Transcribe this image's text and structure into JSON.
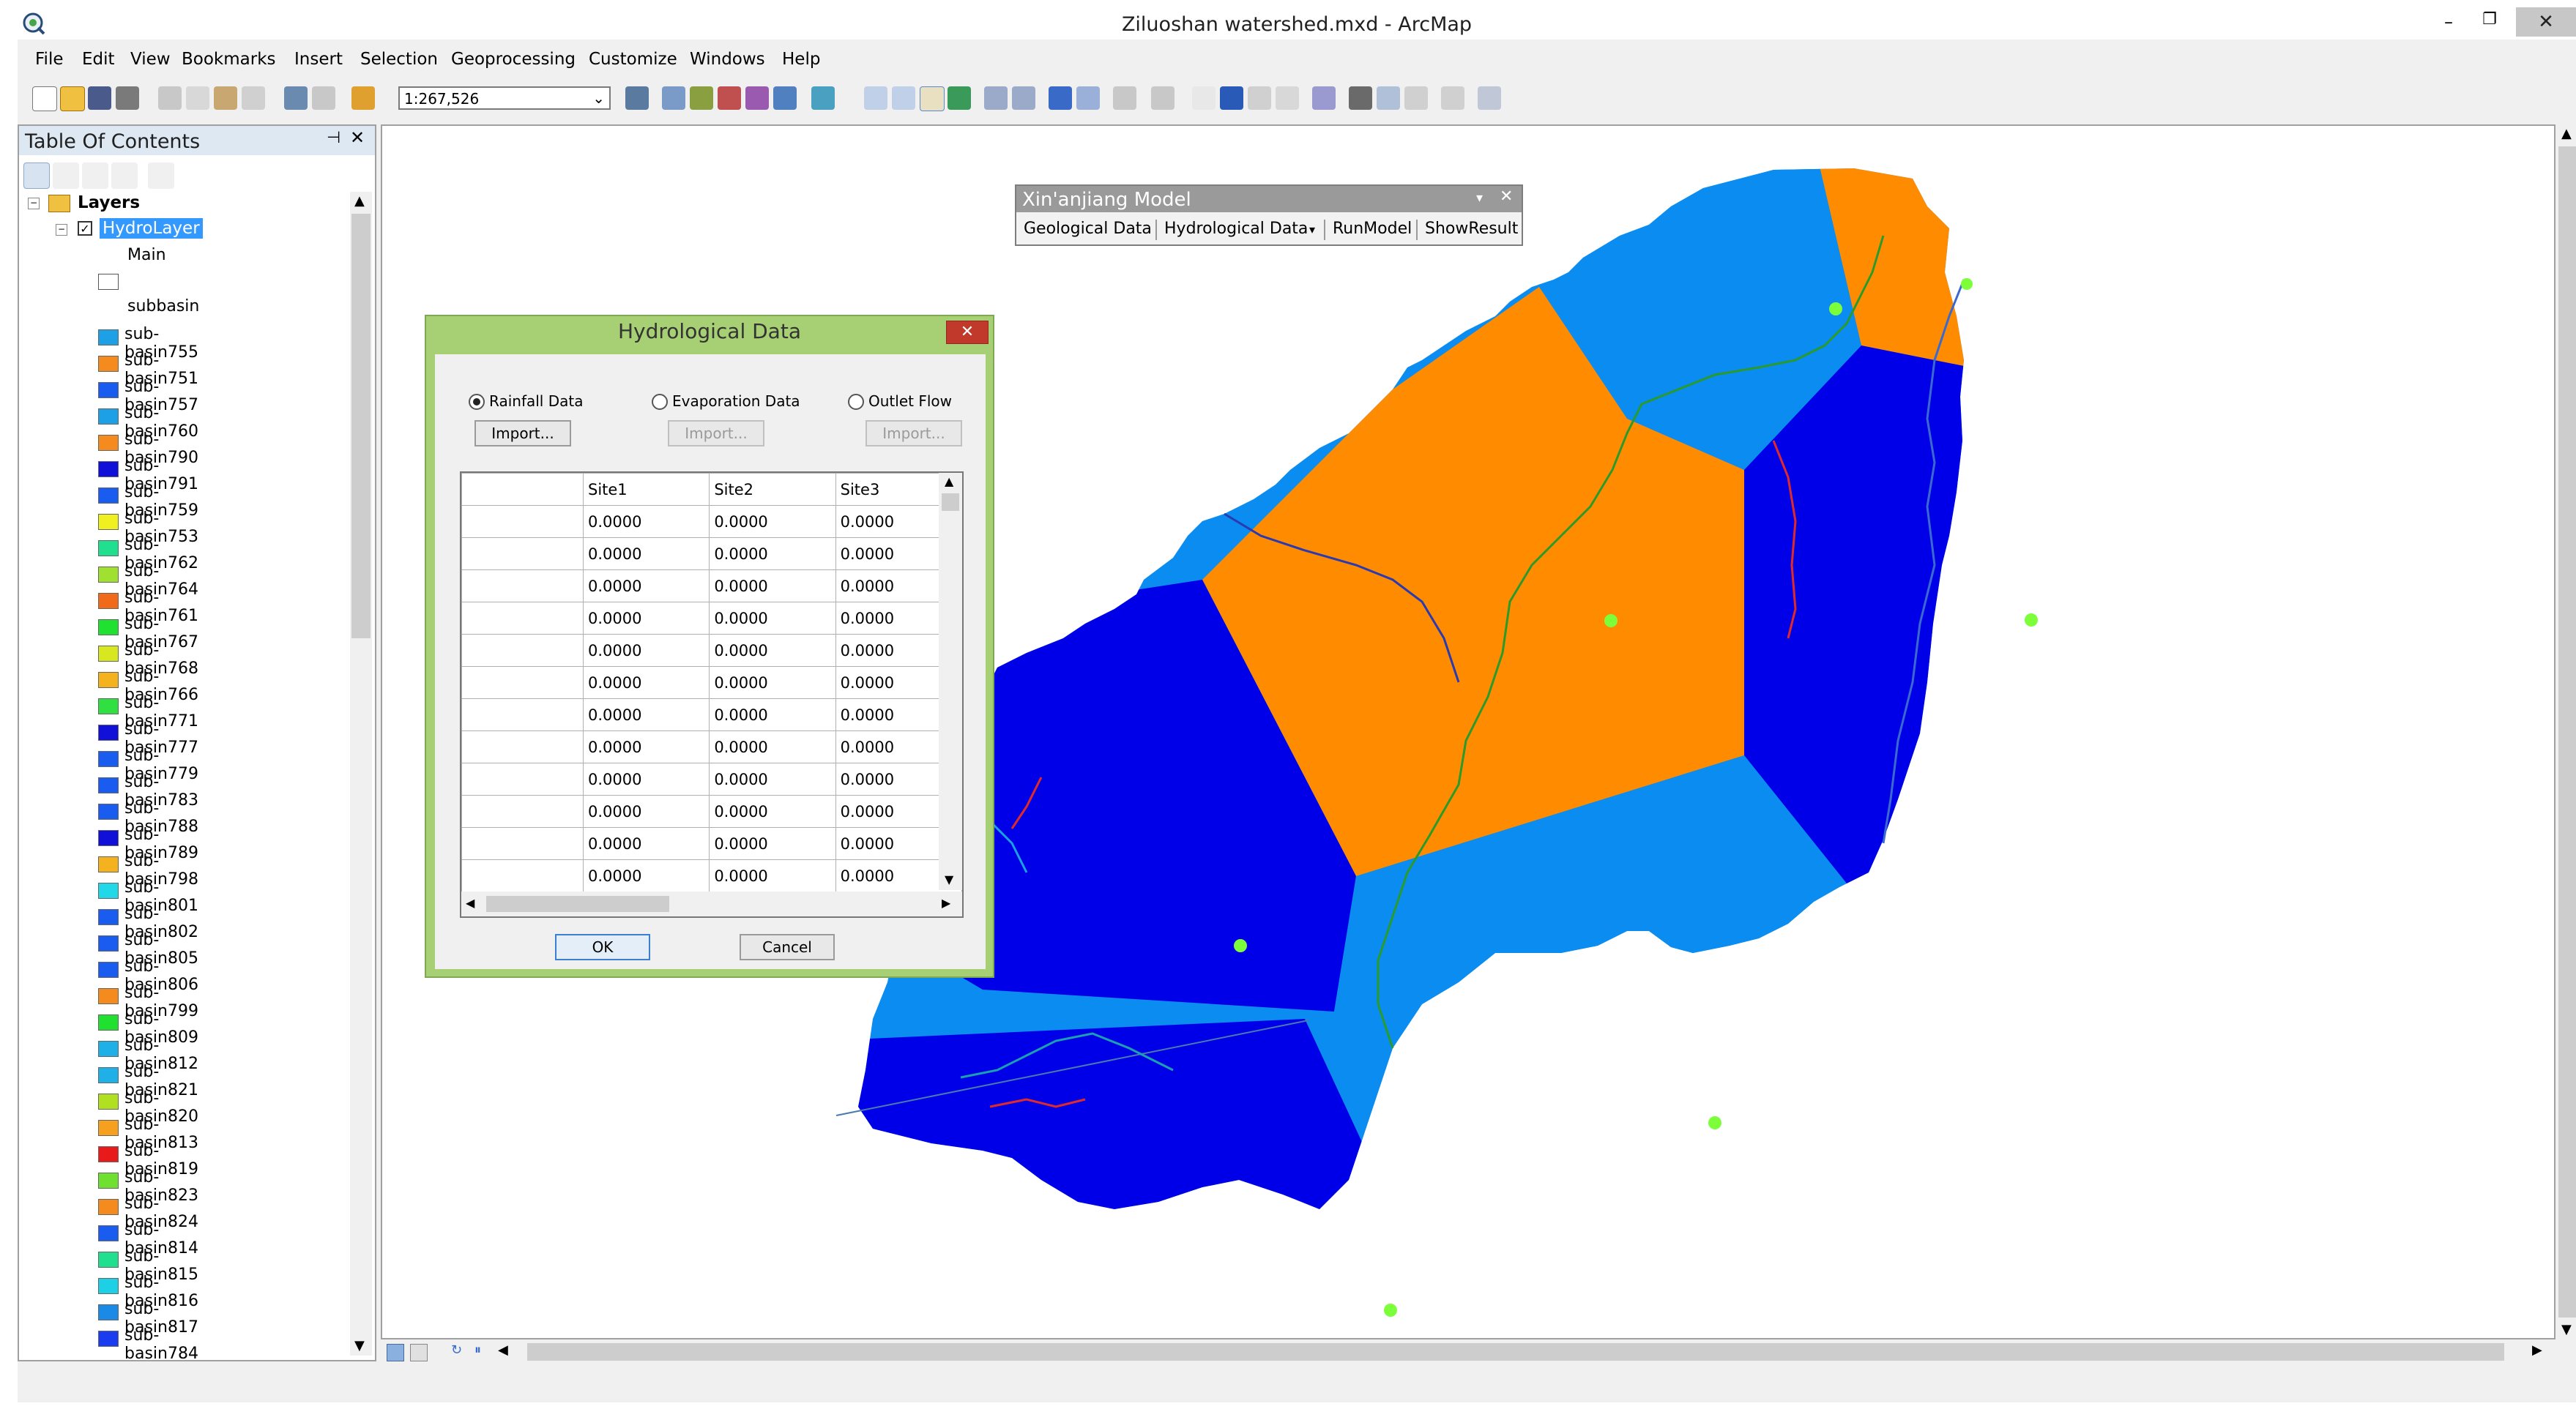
{
  "window": {
    "title": "Ziluoshan watershed.mxd - ArcMap"
  },
  "menu": [
    "File",
    "Edit",
    "View",
    "Bookmarks",
    "Insert",
    "Selection",
    "Geoprocessing",
    "Customize",
    "Windows",
    "Help"
  ],
  "toolbar": {
    "scale_value": "1:267,526"
  },
  "toc": {
    "title": "Table Of Contents",
    "root_label": "Layers",
    "layer_label": "HydroLayer",
    "main_label": "Main",
    "subbasin_label": "subbasin",
    "legend": [
      {
        "label": "sub-basin755",
        "color": "#1ea0e6"
      },
      {
        "label": "sub-basin751",
        "color": "#f58a1f"
      },
      {
        "label": "sub-basin757",
        "color": "#1a5cf0"
      },
      {
        "label": "sub-basin760",
        "color": "#1ea0e6"
      },
      {
        "label": "sub-basin790",
        "color": "#f58a1f"
      },
      {
        "label": "sub-basin791",
        "color": "#1010d8"
      },
      {
        "label": "sub-basin759",
        "color": "#1a5cf0"
      },
      {
        "label": "sub-basin753",
        "color": "#f0f020"
      },
      {
        "label": "sub-basin762",
        "color": "#20e090"
      },
      {
        "label": "sub-basin764",
        "color": "#a0e030"
      },
      {
        "label": "sub-basin761",
        "color": "#f06a1a"
      },
      {
        "label": "sub-basin767",
        "color": "#20e030"
      },
      {
        "label": "sub-basin768",
        "color": "#d8e820"
      },
      {
        "label": "sub-basin766",
        "color": "#f5b21f"
      },
      {
        "label": "sub-basin771",
        "color": "#30e040"
      },
      {
        "label": "sub-basin777",
        "color": "#1010d8"
      },
      {
        "label": "sub-basin779",
        "color": "#1a5cf0"
      },
      {
        "label": "sub-basin783",
        "color": "#1a5cf0"
      },
      {
        "label": "sub-basin788",
        "color": "#1a5cf0"
      },
      {
        "label": "sub-basin789",
        "color": "#1010d8"
      },
      {
        "label": "sub-basin798",
        "color": "#f5b21f"
      },
      {
        "label": "sub-basin801",
        "color": "#20d8e8"
      },
      {
        "label": "sub-basin802",
        "color": "#1a5cf0"
      },
      {
        "label": "sub-basin805",
        "color": "#1a5cf0"
      },
      {
        "label": "sub-basin806",
        "color": "#1a5cf0"
      },
      {
        "label": "sub-basin799",
        "color": "#f58a1f"
      },
      {
        "label": "sub-basin809",
        "color": "#20e030"
      },
      {
        "label": "sub-basin812",
        "color": "#1eb0e6"
      },
      {
        "label": "sub-basin821",
        "color": "#1eb0e6"
      },
      {
        "label": "sub-basin820",
        "color": "#b0e020"
      },
      {
        "label": "sub-basin813",
        "color": "#f5a01f"
      },
      {
        "label": "sub-basin819",
        "color": "#e81a1a"
      },
      {
        "label": "sub-basin823",
        "color": "#70e030"
      },
      {
        "label": "sub-basin824",
        "color": "#f58a1f"
      },
      {
        "label": "sub-basin814",
        "color": "#1a5cf0"
      },
      {
        "label": "sub-basin815",
        "color": "#20e090"
      },
      {
        "label": "sub-basin816",
        "color": "#1ed0e6"
      },
      {
        "label": "sub-basin817",
        "color": "#1a8ae6"
      },
      {
        "label": "sub-basin784",
        "color": "#1a3cf0"
      }
    ]
  },
  "toolbar_xaj": {
    "title": "Xin'anjiang Model",
    "items": [
      "Geological Data",
      "Hydrological Data",
      "RunModel",
      "ShowResult"
    ]
  },
  "dialog": {
    "title": "Hydrological Data",
    "radios": [
      {
        "label": "Rainfall Data",
        "selected": true
      },
      {
        "label": "Evaporation Data",
        "selected": false
      },
      {
        "label": "Outlet Flow",
        "selected": false
      }
    ],
    "import_label": "Import...",
    "columns": [
      "Site1",
      "Site2",
      "Site3"
    ],
    "rows": [
      [
        "0.0000",
        "0.0000",
        "0.0000"
      ],
      [
        "0.0000",
        "0.0000",
        "0.0000"
      ],
      [
        "0.0000",
        "0.0000",
        "0.0000"
      ],
      [
        "0.0000",
        "0.0000",
        "0.0000"
      ],
      [
        "0.0000",
        "0.0000",
        "0.0000"
      ],
      [
        "0.0000",
        "0.0000",
        "0.0000"
      ],
      [
        "0.0000",
        "0.0000",
        "0.0000"
      ],
      [
        "0.0000",
        "0.0000",
        "0.0000"
      ],
      [
        "0.0000",
        "0.0000",
        "0.0000"
      ],
      [
        "0.0000",
        "0.0000",
        "0.0000"
      ],
      [
        "0.0000",
        "0.0000",
        "0.0000"
      ],
      [
        "0.0000",
        "0.0000",
        "0.0000"
      ]
    ],
    "ok_label": "OK",
    "cancel_label": "Cancel"
  },
  "map_colors": {
    "orange": "#ff8c00",
    "light_blue": "#0a8cf0",
    "dark_blue": "#0000e8",
    "site_point": "#7cff3a"
  }
}
